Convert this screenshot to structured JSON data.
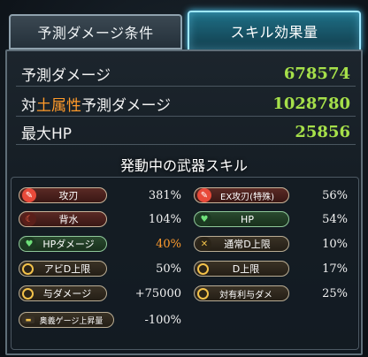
{
  "tabs": {
    "left": "予測ダメージ条件",
    "right": "スキル効果量"
  },
  "stats": [
    {
      "label": "予測ダメージ",
      "value": "678574"
    },
    {
      "label_pre": "対",
      "label_element": "土属性",
      "label_post": "予測ダメージ",
      "value": "1028780"
    },
    {
      "label": "最大HP",
      "value": "25856"
    }
  ],
  "section_title": "発動中の武器スキル",
  "skills_left": [
    {
      "label": "攻刃",
      "value": "381%"
    },
    {
      "label": "背水",
      "value": "104%"
    },
    {
      "label": "HPダメージ",
      "value": "40%"
    },
    {
      "label": "アビD上限",
      "value": "50%"
    },
    {
      "label": "与ダメージ",
      "value": "+75000"
    },
    {
      "label": "奥義ゲージ上昇量",
      "value": "-100%"
    }
  ],
  "skills_right": [
    {
      "label": "EX攻刃(特殊)",
      "value": "56%"
    },
    {
      "label": "HP",
      "value": "54%"
    },
    {
      "label": "通常D上限",
      "value": "10%"
    },
    {
      "label": "D上限",
      "value": "17%"
    },
    {
      "label": "対有利与ダメ",
      "value": "25%"
    }
  ],
  "colors": {
    "stat_value": "#a6e04a",
    "earth_element": "#ff9a2a",
    "hp_damage_value": "#ff9c2e",
    "active_tab_glow": "#4fd2ff"
  },
  "icons": {
    "attack": "sword-icon",
    "enmity": "moon-icon",
    "hp_damage": "heart-icon",
    "cap": "ring-icon",
    "normal_cap": "crossed-swords-icon",
    "ougi_gauge": "gauge-bar-icon"
  }
}
